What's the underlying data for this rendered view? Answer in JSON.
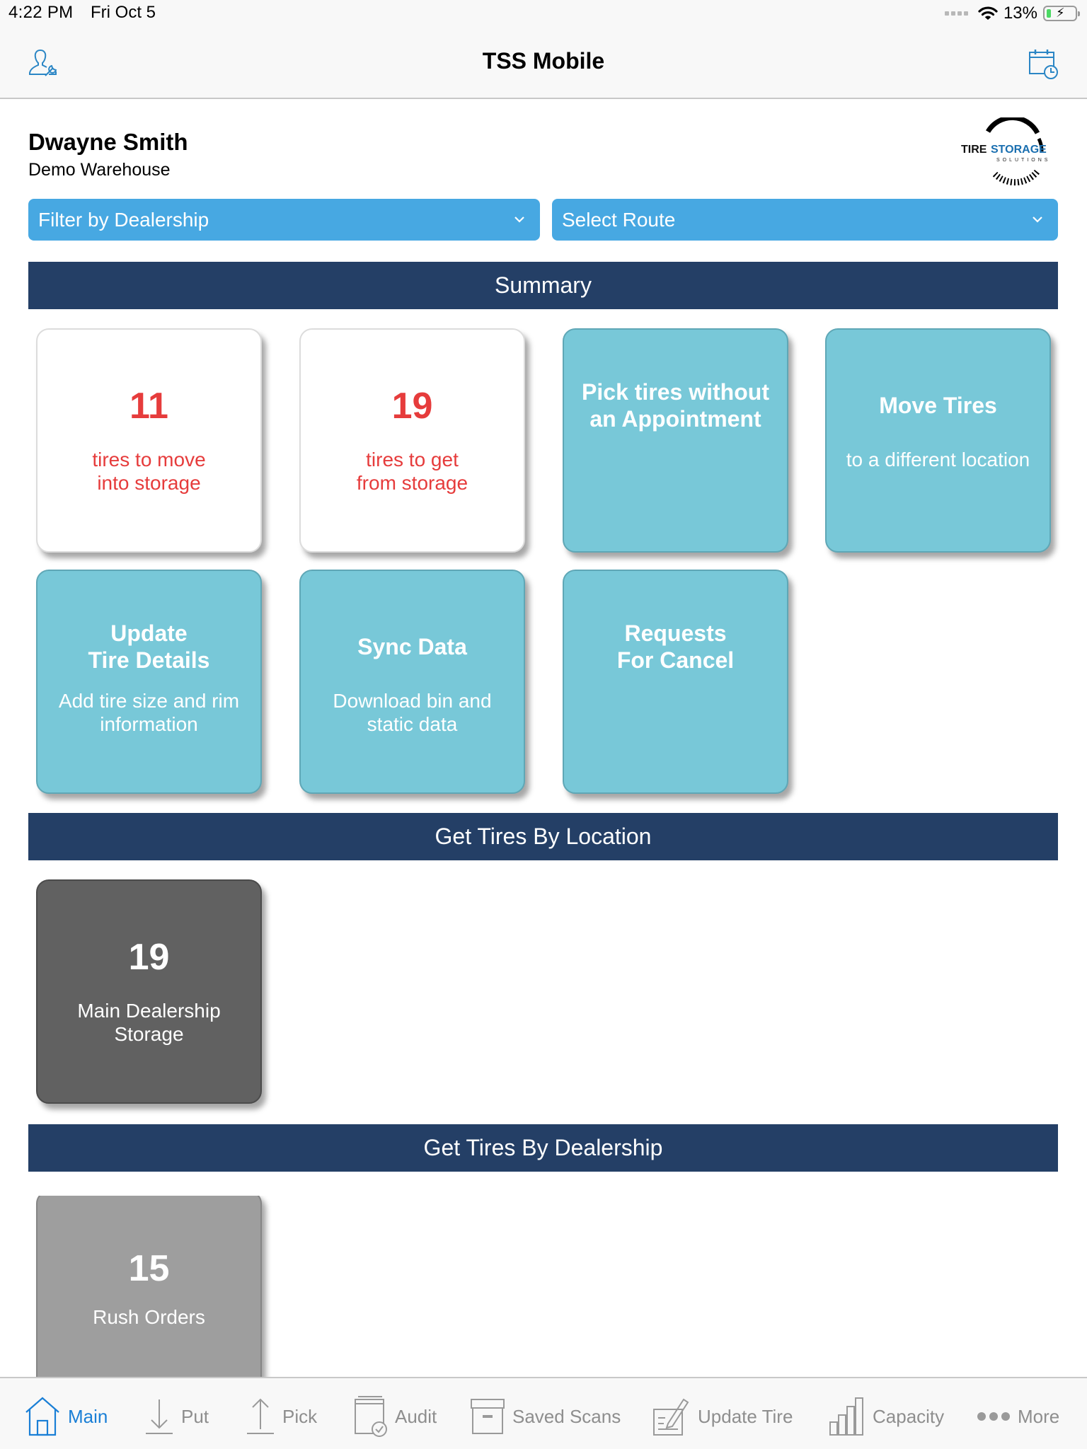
{
  "status_bar": {
    "time": "4:22 PM",
    "date": "Fri Oct 5",
    "battery_percent": "13%",
    "battery_level": 0.13,
    "charging": true
  },
  "nav": {
    "title": "TSS Mobile",
    "left_icon": "user-wrench-icon",
    "right_icon": "calendar-clock-icon"
  },
  "header": {
    "user_name": "Dwayne Smith",
    "warehouse": "Demo Warehouse",
    "logo": {
      "word1": "TIRE",
      "word2": "STORAGE",
      "tagline": "SOLUTIONS"
    }
  },
  "filters": {
    "dealership": {
      "value": "Filter by Dealership"
    },
    "route": {
      "value": "Select Route"
    }
  },
  "colors": {
    "band": "#243f66",
    "dropdown": "#47a8e2",
    "teal_tile": "#78c8d8",
    "alert_red": "#e63c3c",
    "active_tab": "#1a7fd6"
  },
  "summary": {
    "title": "Summary",
    "tiles": [
      {
        "number": "11",
        "desc_line1": "tires to move",
        "desc_line2": "into storage"
      },
      {
        "number": "19",
        "desc_line1": "tires to get",
        "desc_line2": "from storage"
      },
      {
        "title_line1": "Pick tires without",
        "title_line2": "an Appointment"
      },
      {
        "title": "Move Tires",
        "desc": "to a different location"
      },
      {
        "title_line1": "Update",
        "title_line2": "Tire Details",
        "desc_line1": "Add tire size and rim",
        "desc_line2": "information"
      },
      {
        "title": "Sync Data",
        "desc_line1": "Download bin and",
        "desc_line2": "static data"
      },
      {
        "title_line1": "Requests",
        "title_line2": "For Cancel"
      }
    ]
  },
  "by_location": {
    "title": "Get Tires By Location",
    "tiles": [
      {
        "number": "19",
        "label_line1": "Main Dealership",
        "label_line2": "Storage"
      }
    ]
  },
  "by_dealership": {
    "title": "Get Tires By Dealership",
    "tiles": [
      {
        "number": "15",
        "label": "Rush Orders"
      }
    ]
  },
  "tabbar": {
    "items": [
      {
        "label": "Main",
        "icon": "home-icon",
        "active": true
      },
      {
        "label": "Put",
        "icon": "arrow-down-icon"
      },
      {
        "label": "Pick",
        "icon": "arrow-up-icon"
      },
      {
        "label": "Audit",
        "icon": "audit-icon"
      },
      {
        "label": "Saved Scans",
        "icon": "archive-box-icon"
      },
      {
        "label": "Update Tire",
        "icon": "edit-form-icon"
      },
      {
        "label": "Capacity",
        "icon": "bar-chart-icon"
      },
      {
        "label": "More",
        "icon": "more-dots-icon"
      }
    ]
  }
}
